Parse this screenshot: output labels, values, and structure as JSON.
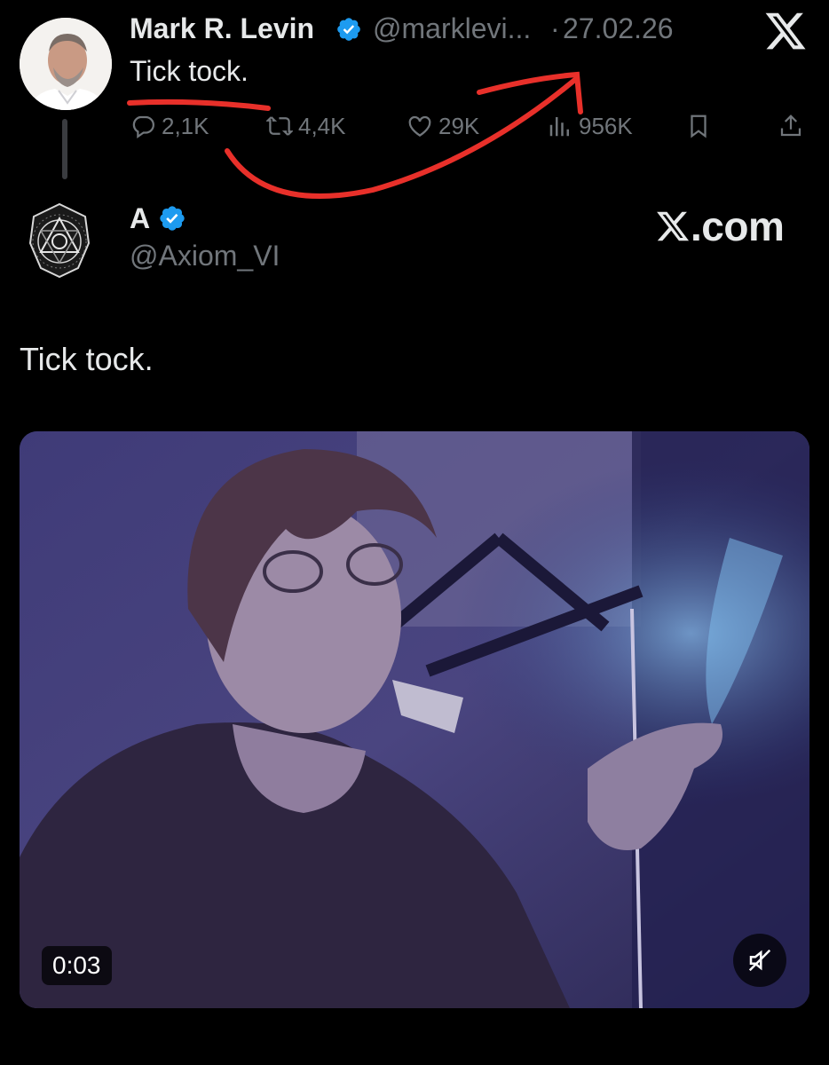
{
  "main_tweet": {
    "display_name": "Mark R. Levin",
    "handle": "@marklevi...",
    "separator": "·",
    "date": "27.02.26",
    "text": "Tick tock.",
    "verified": true,
    "actions": {
      "replies": "2,1K",
      "retweets": "4,4K",
      "likes": "29K",
      "views": "956K"
    }
  },
  "quoted_tweet": {
    "display_name": "A",
    "handle": "@Axiom_VI",
    "verified": true,
    "text": "Tick tock.",
    "watermark": ".com",
    "video": {
      "timestamp": "0:03",
      "muted": true
    }
  },
  "colors": {
    "background": "#000000",
    "primary_text": "#e7e9ea",
    "secondary_text": "#71767b",
    "verified_badge": "#1d9bf0",
    "annotation": "#e8302a"
  },
  "icons": [
    "x-logo-icon",
    "verified-badge-icon",
    "reply-icon",
    "retweet-icon",
    "like-icon",
    "views-icon",
    "bookmark-icon",
    "share-icon",
    "muted-speaker-icon"
  ]
}
